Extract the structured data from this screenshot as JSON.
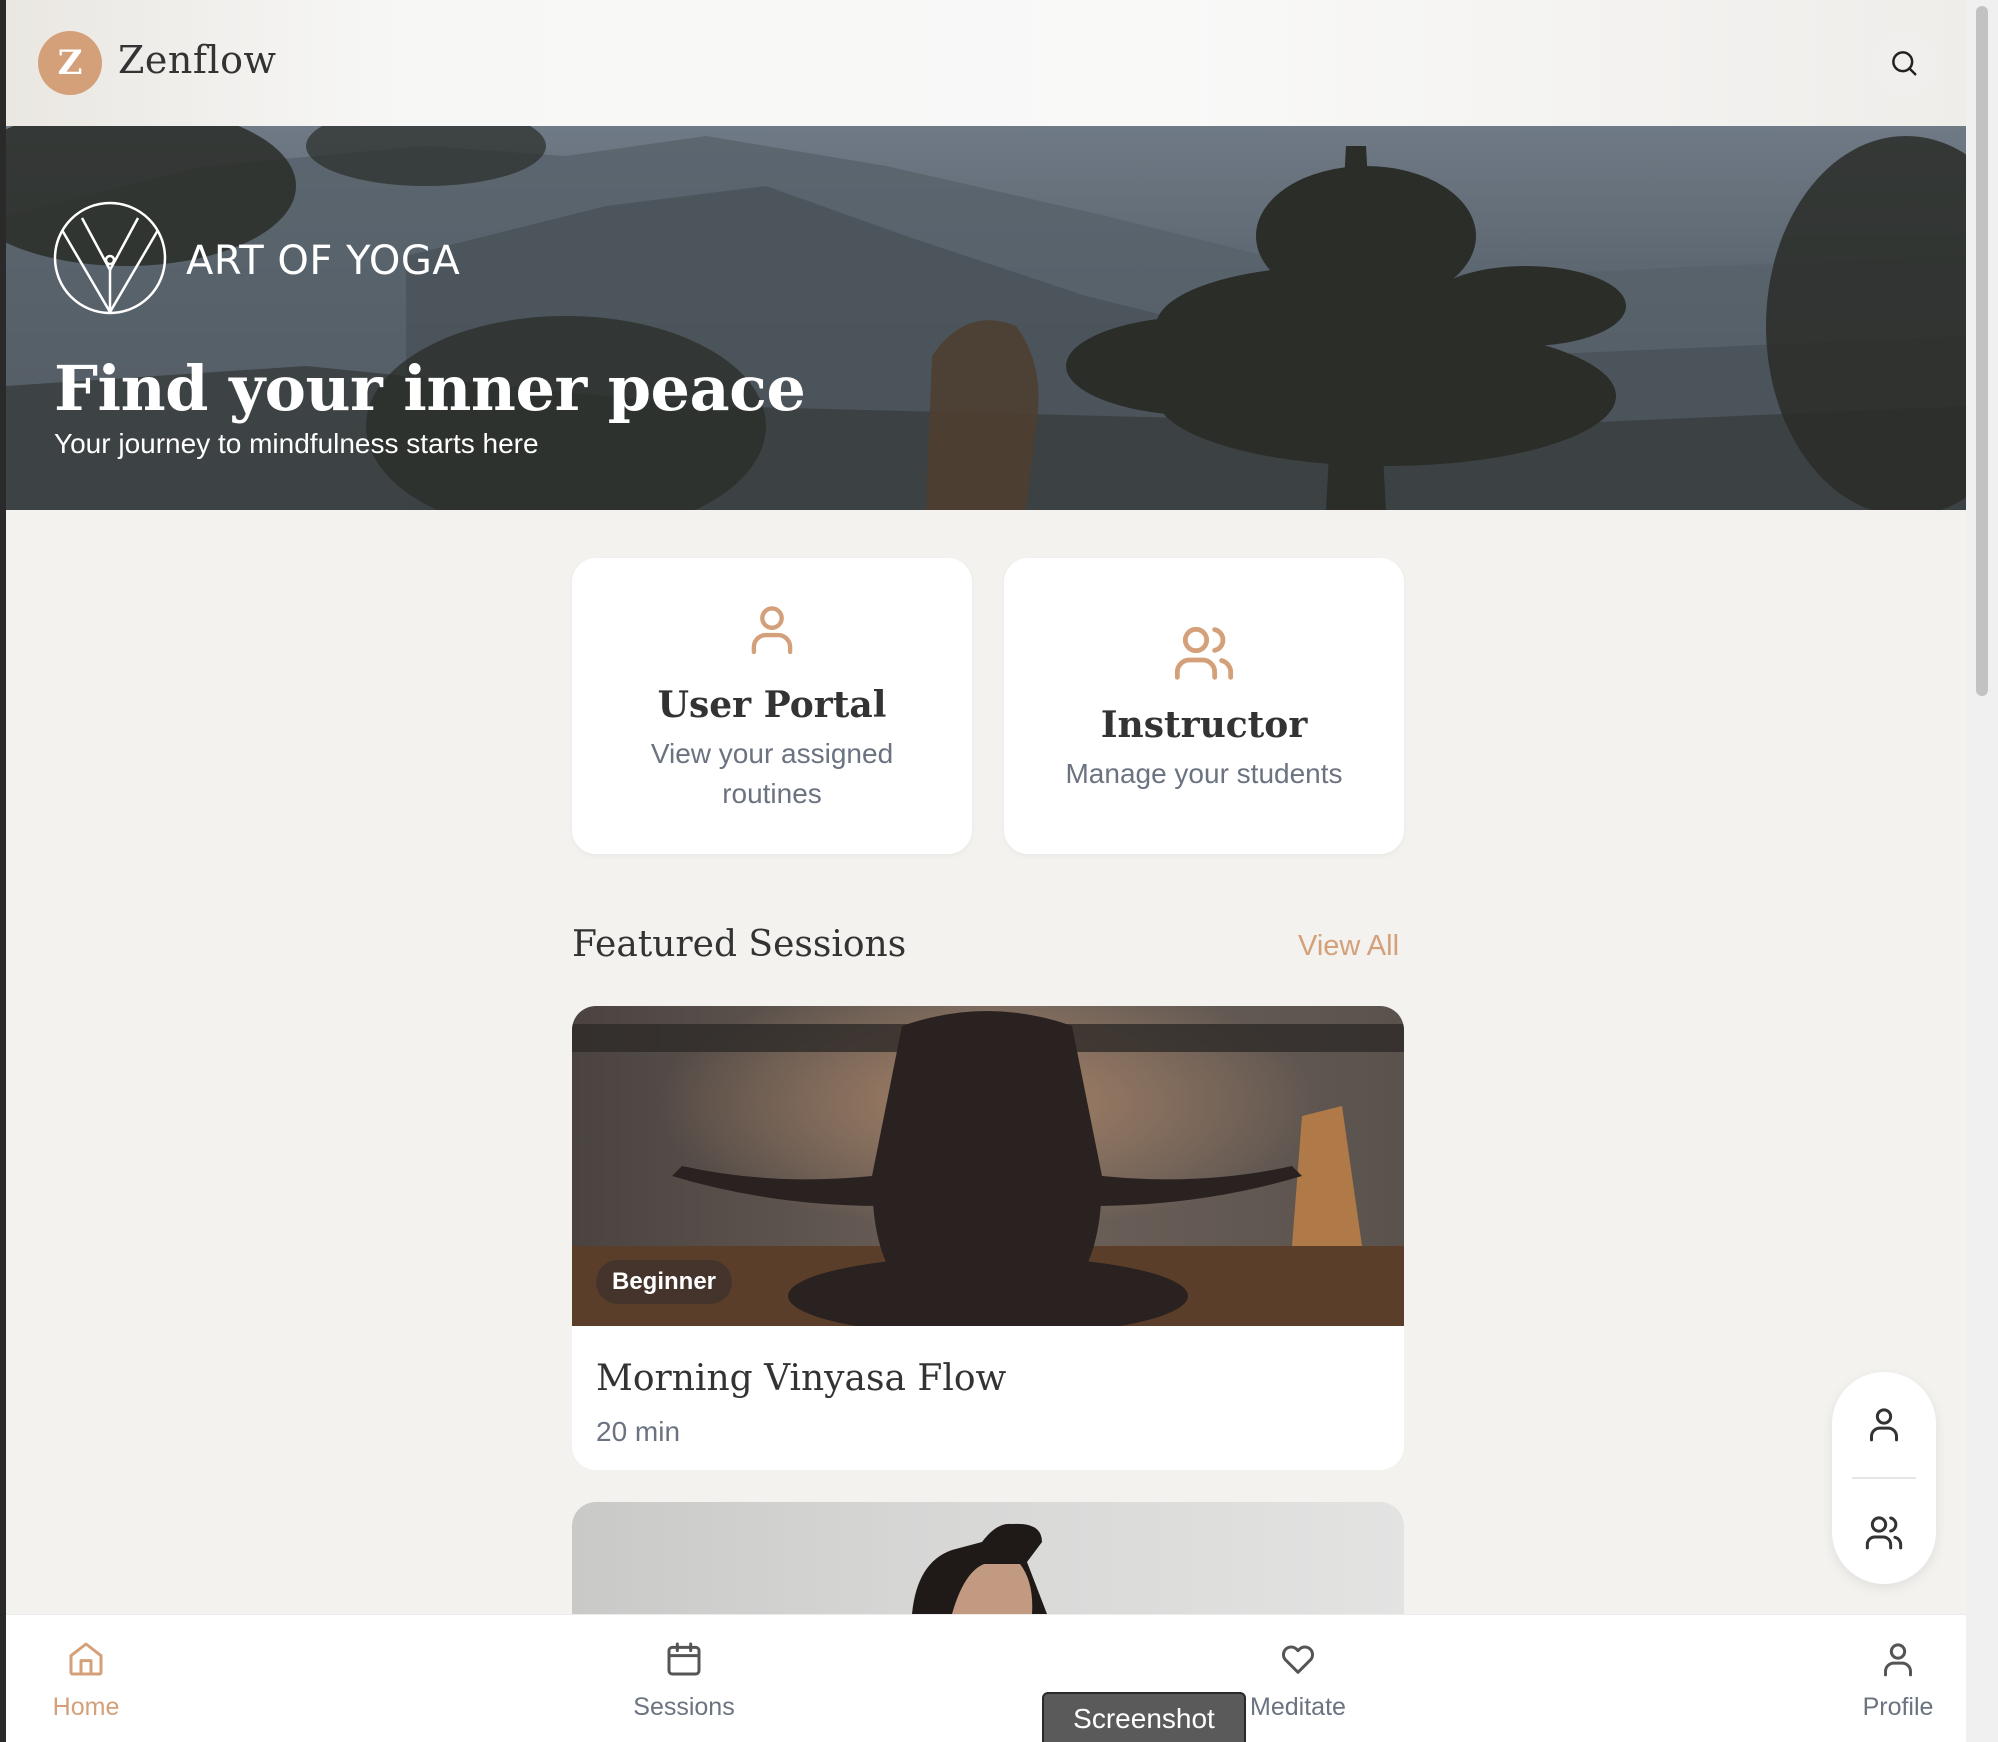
{
  "app": {
    "initial": "Z",
    "name": "Zenflow"
  },
  "hero": {
    "brand_text": "ART OF YOGA",
    "title": "Find your inner peace",
    "subtitle": "Your journey to mindfulness starts here"
  },
  "portals": [
    {
      "title": "User Portal",
      "description": "View your assigned routines",
      "icon": "user-icon"
    },
    {
      "title": "Instructor",
      "description": "Manage your students",
      "icon": "users-icon"
    }
  ],
  "featured": {
    "heading": "Featured Sessions",
    "view_all": "View All",
    "sessions": [
      {
        "level": "Beginner",
        "title": "Morning Vinyasa Flow",
        "duration": "20 min"
      }
    ]
  },
  "nav": {
    "items": [
      {
        "label": "Home",
        "icon": "home-icon",
        "active": true
      },
      {
        "label": "Sessions",
        "icon": "calendar-icon",
        "active": false
      },
      {
        "label": "Meditate",
        "icon": "heart-icon",
        "active": false
      },
      {
        "label": "Profile",
        "icon": "user-icon",
        "active": false
      }
    ]
  },
  "overlay": {
    "tooltip": "Screenshot"
  },
  "colors": {
    "accent": "#d4a07a",
    "background": "#f3f2ef",
    "text": "#333333",
    "muted": "#6b7280"
  }
}
